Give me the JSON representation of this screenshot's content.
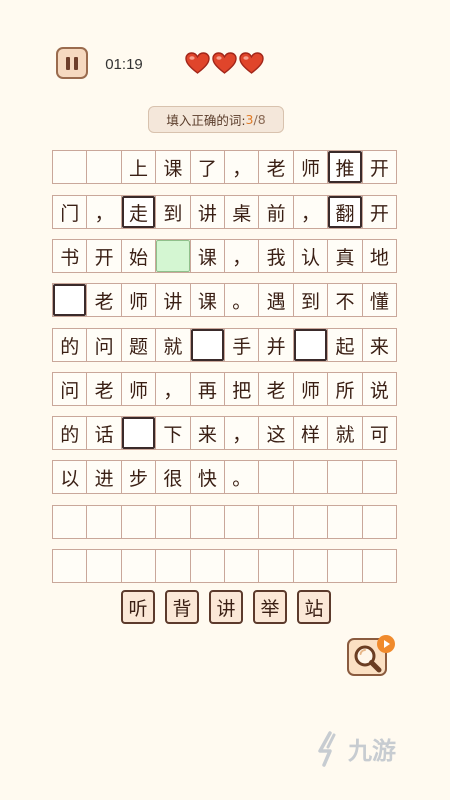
{
  "top_bar": {
    "timer": "01:19",
    "lives": 3
  },
  "progress": {
    "label": "填入正确的词:",
    "current": "3",
    "separator": "/",
    "total": "8"
  },
  "grid": {
    "rows": [
      [
        {
          "t": ""
        },
        {
          "t": ""
        },
        {
          "t": "上"
        },
        {
          "t": "课"
        },
        {
          "t": "了"
        },
        {
          "t": "，"
        },
        {
          "t": "老"
        },
        {
          "t": "师"
        },
        {
          "t": "推",
          "box": "filled"
        },
        {
          "t": "开"
        }
      ],
      [
        {
          "t": "门"
        },
        {
          "t": "，"
        },
        {
          "t": "走",
          "box": "filled"
        },
        {
          "t": "到"
        },
        {
          "t": "讲"
        },
        {
          "t": "桌"
        },
        {
          "t": "前"
        },
        {
          "t": "，"
        },
        {
          "t": "翻",
          "box": "filled"
        },
        {
          "t": "开"
        }
      ],
      [
        {
          "t": "书"
        },
        {
          "t": "开"
        },
        {
          "t": "始"
        },
        {
          "t": "",
          "box": "active"
        },
        {
          "t": "课"
        },
        {
          "t": "，"
        },
        {
          "t": "我"
        },
        {
          "t": "认"
        },
        {
          "t": "真"
        },
        {
          "t": "地"
        }
      ],
      [
        {
          "t": "",
          "box": "empty"
        },
        {
          "t": "老"
        },
        {
          "t": "师"
        },
        {
          "t": "讲"
        },
        {
          "t": "课"
        },
        {
          "t": "。"
        },
        {
          "t": "遇"
        },
        {
          "t": "到"
        },
        {
          "t": "不"
        },
        {
          "t": "懂"
        }
      ],
      [
        {
          "t": "的"
        },
        {
          "t": "问"
        },
        {
          "t": "题"
        },
        {
          "t": "就"
        },
        {
          "t": "",
          "box": "empty"
        },
        {
          "t": "手"
        },
        {
          "t": "并"
        },
        {
          "t": "",
          "box": "empty"
        },
        {
          "t": "起"
        },
        {
          "t": "来"
        }
      ],
      [
        {
          "t": "问"
        },
        {
          "t": "老"
        },
        {
          "t": "师"
        },
        {
          "t": "，"
        },
        {
          "t": "再"
        },
        {
          "t": "把"
        },
        {
          "t": "老"
        },
        {
          "t": "师"
        },
        {
          "t": "所"
        },
        {
          "t": "说"
        }
      ],
      [
        {
          "t": "的"
        },
        {
          "t": "话"
        },
        {
          "t": "",
          "box": "empty"
        },
        {
          "t": "下"
        },
        {
          "t": "来"
        },
        {
          "t": "，"
        },
        {
          "t": "这"
        },
        {
          "t": "样"
        },
        {
          "t": "就"
        },
        {
          "t": "可"
        }
      ],
      [
        {
          "t": "以"
        },
        {
          "t": "进"
        },
        {
          "t": "步"
        },
        {
          "t": "很"
        },
        {
          "t": "快"
        },
        {
          "t": "。"
        },
        {
          "t": ""
        },
        {
          "t": ""
        },
        {
          "t": ""
        },
        {
          "t": ""
        }
      ],
      [
        {
          "t": ""
        },
        {
          "t": ""
        },
        {
          "t": ""
        },
        {
          "t": ""
        },
        {
          "t": ""
        },
        {
          "t": ""
        },
        {
          "t": ""
        },
        {
          "t": ""
        },
        {
          "t": ""
        },
        {
          "t": ""
        }
      ],
      [
        {
          "t": ""
        },
        {
          "t": ""
        },
        {
          "t": ""
        },
        {
          "t": ""
        },
        {
          "t": ""
        },
        {
          "t": ""
        },
        {
          "t": ""
        },
        {
          "t": ""
        },
        {
          "t": ""
        },
        {
          "t": ""
        }
      ]
    ]
  },
  "tiles": [
    "听",
    "背",
    "讲",
    "举",
    "站"
  ],
  "icons": {
    "pause": "pause-icon",
    "heart": "heart-icon",
    "hint": "magnifier-icon",
    "play": "play-icon",
    "watermark": "logo-icon"
  },
  "colors": {
    "background": "#fffaf0",
    "heart": "#e0452b",
    "active_cell": "#d4f6d2",
    "accent": "#e07b27"
  },
  "watermark": {
    "text": "九游"
  }
}
